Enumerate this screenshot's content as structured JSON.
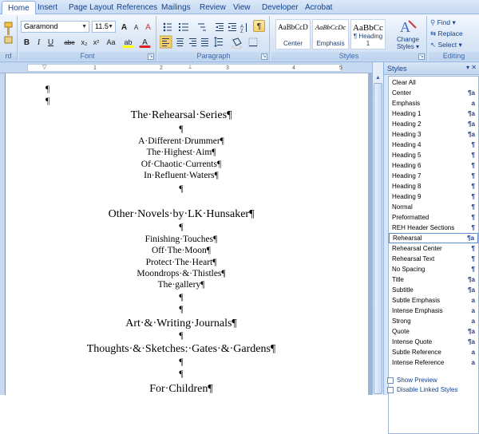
{
  "tabs": [
    "Home",
    "Insert",
    "Page Layout",
    "References",
    "Mailings",
    "Review",
    "View",
    "Developer",
    "Acrobat"
  ],
  "font": {
    "name": "Garamond",
    "size": "11.5",
    "group_label": "Font",
    "bold": "B",
    "italic": "I",
    "underline": "U",
    "strike": "abe",
    "sub": "x₂",
    "sup": "x²",
    "change_case": "Aa",
    "grow": "A",
    "shrink": "A",
    "clear": "A",
    "highlight": "ab",
    "color": "A"
  },
  "clipboard": {
    "group_label": "rd"
  },
  "paragraph": {
    "group_label": "Paragraph",
    "pilcrow": "¶"
  },
  "styles_group": {
    "group_label": "Styles",
    "quick_styles": [
      {
        "preview": "AaBbCcD",
        "name": "Center"
      },
      {
        "preview": "AaBbCcDc",
        "name": "Emphasis"
      },
      {
        "preview": "AaBbCc",
        "name": "¶ Heading 1"
      }
    ],
    "change_styles": "Change Styles",
    "change_styles_arrow": "▾"
  },
  "editing": {
    "group_label": "Editing",
    "find": "Find",
    "replace": "Replace",
    "select": "Select"
  },
  "ruler_numbers": [
    "1",
    "2",
    "3",
    "4",
    "5"
  ],
  "document": {
    "lines": [
      "¶",
      "¶",
      "The·Rehearsal·Series¶",
      "¶",
      "A·Different·Drummer¶",
      "The·Highest·Aim¶",
      "Of·Chaotic·Currents¶",
      "In·Refluent·Waters¶",
      "¶",
      "Other·Novels·by·LK·Hunsaker¶",
      "¶",
      "Finishing·Touches¶",
      "Off·The·Moon¶",
      "Protect·The·Heart¶",
      "Moondrops·&·Thistles¶",
      "The·gallery¶",
      "¶",
      "¶",
      "Art·&·Writing·Journals¶",
      "¶",
      "Thoughts·&·Sketches:·Gates·&·Gardens¶",
      "¶",
      "¶",
      "For·Children¶"
    ]
  },
  "styles_pane": {
    "title": "Styles",
    "close": "✕",
    "items": [
      {
        "name": "Clear All",
        "type": ""
      },
      {
        "name": "Center",
        "type": "¶a"
      },
      {
        "name": "Emphasis",
        "type": "a"
      },
      {
        "name": "Heading 1",
        "type": "¶a"
      },
      {
        "name": "Heading 2",
        "type": "¶a"
      },
      {
        "name": "Heading 3",
        "type": "¶a"
      },
      {
        "name": "Heading 4",
        "type": "¶"
      },
      {
        "name": "Heading 5",
        "type": "¶"
      },
      {
        "name": "Heading 6",
        "type": "¶"
      },
      {
        "name": "Heading 7",
        "type": "¶"
      },
      {
        "name": "Heading 8",
        "type": "¶"
      },
      {
        "name": "Heading 9",
        "type": "¶"
      },
      {
        "name": "Normal",
        "type": "¶"
      },
      {
        "name": "Preformatted",
        "type": "¶"
      },
      {
        "name": "REH Header Sections",
        "type": "¶"
      },
      {
        "name": "Rehearsal",
        "type": "¶a"
      },
      {
        "name": "Rehearsal Center",
        "type": "¶"
      },
      {
        "name": "Rehearsal Text",
        "type": "¶"
      },
      {
        "name": "No Spacing",
        "type": "¶"
      },
      {
        "name": "Title",
        "type": "¶a"
      },
      {
        "name": "Subtitle",
        "type": "¶a"
      },
      {
        "name": "Subtle Emphasis",
        "type": "a"
      },
      {
        "name": "Intense Emphasis",
        "type": "a"
      },
      {
        "name": "Strong",
        "type": "a"
      },
      {
        "name": "Quote",
        "type": "¶a"
      },
      {
        "name": "Intense Quote",
        "type": "¶a"
      },
      {
        "name": "Subtle Reference",
        "type": "a"
      },
      {
        "name": "Intense Reference",
        "type": "a"
      }
    ],
    "selected": "Rehearsal",
    "show_preview": "Show Preview",
    "disable_linked": "Disable Linked Styles"
  }
}
